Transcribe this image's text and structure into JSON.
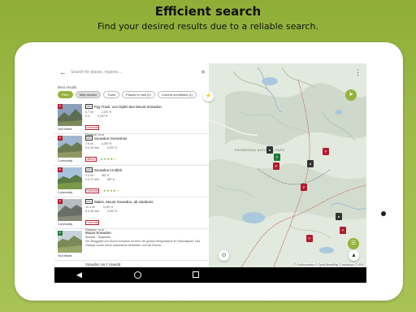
{
  "header": {
    "title": "Efficient search",
    "subtitle": "Find your desired results due to a reliable search."
  },
  "search": {
    "placeholder": "Search for places, regions,...",
    "clear_icon": "close-icon",
    "back_icon": "arrow-left-icon"
  },
  "best_results_label": "Best results",
  "chips": [
    "Filter",
    "Map section",
    "Tours",
    "Places to visit (1)",
    "Current conditions (1)"
  ],
  "results": [
    {
      "title": "Pyg Track: von Gipfel des Mount Snowdon",
      "badge": "WK",
      "dist": "6.7 mi",
      "up": "2,297 ft",
      "time": "3 h",
      "down": "2,297 ft",
      "difficulty": "moderate",
      "extra": "Distance: m.w.",
      "author": "Visit Wales",
      "pin": "P"
    },
    {
      "title": "Snowdon Horseshoe",
      "badge": "WK",
      "dist": "7.6 mi",
      "up": "3,297 ft",
      "time": "5 h 30 min",
      "down": "3,297 ft",
      "difficulty": "difficult",
      "stars": "★★★★☆",
      "author": "Community",
      "pin": "P"
    },
    {
      "title": "Snowdon im Blick",
      "badge": "WK",
      "dist": "2.3 mi",
      "up": "367 ft",
      "time": "0 h 17 min",
      "down": "367 ft",
      "difficulty": "moderate",
      "stars": "★★★★☆",
      "author": "Community",
      "pin": "P"
    },
    {
      "title": "Wales, Mount Snowdon, ab Llanberis",
      "badge": "WK",
      "dist": "10.4 mi",
      "up": "3,297 ft",
      "time": "5 h 25 min",
      "down": "3,297 ft",
      "difficulty": "moderate",
      "extra": "Distance: m.w.",
      "author": "Community",
      "pin": "P"
    },
    {
      "title": "Mount Snowdon",
      "sub": "Summit · Gwynedd",
      "desc": "Der Berggipfel von Mount Snowdon ist einer der großen Bergmassive im Nationalpark. Das Gebirge wurde durch vulkanische Aktivitäten und die Eiszeit...",
      "author": "Visit Wales",
      "pin": "P"
    }
  ],
  "partial_item": "Snowdon via Y Lliwedd",
  "map": {
    "overflow_icon": "more-vert-icon",
    "route_icon": "route-icon",
    "nav_icon": "navigation-icon",
    "layers_icon": "layers-icon",
    "locate_icon": "my-location-icon",
    "compass_icon": "compass-icon",
    "attribution": "© Outdooractive  © OpenStreetMap  © swisstopo  © IGN",
    "label_1": "SNOWDONIA NATIONAL PARK"
  },
  "colors": {
    "accent": "#94b33c",
    "pin_red": "#b01e2f",
    "pin_green": "#1e7a3a"
  }
}
